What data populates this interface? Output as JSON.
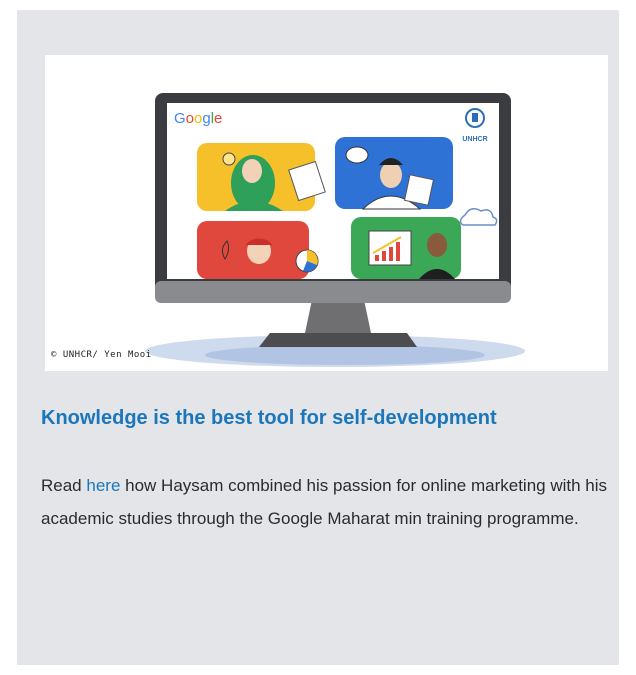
{
  "article": {
    "image": {
      "google_logo": "Google",
      "unhcr_logo": "UNHCR",
      "credit": "© UNHCR/ Yen Mooi"
    },
    "title": "Knowledge is the best tool for self-development",
    "body": {
      "before_link": "Read ",
      "link": "here",
      "after_link": " how Haysam combined his passion for online marketing with his academic studies through the Google Maharat min training programme."
    }
  },
  "colors": {
    "card_bg": "#e3e5e8",
    "title": "#1b76bb",
    "link": "#1b76bb",
    "panel_yellow": "#f5c02a",
    "panel_blue": "#2f72d6",
    "panel_red": "#e0473d",
    "panel_green": "#3aa857"
  }
}
